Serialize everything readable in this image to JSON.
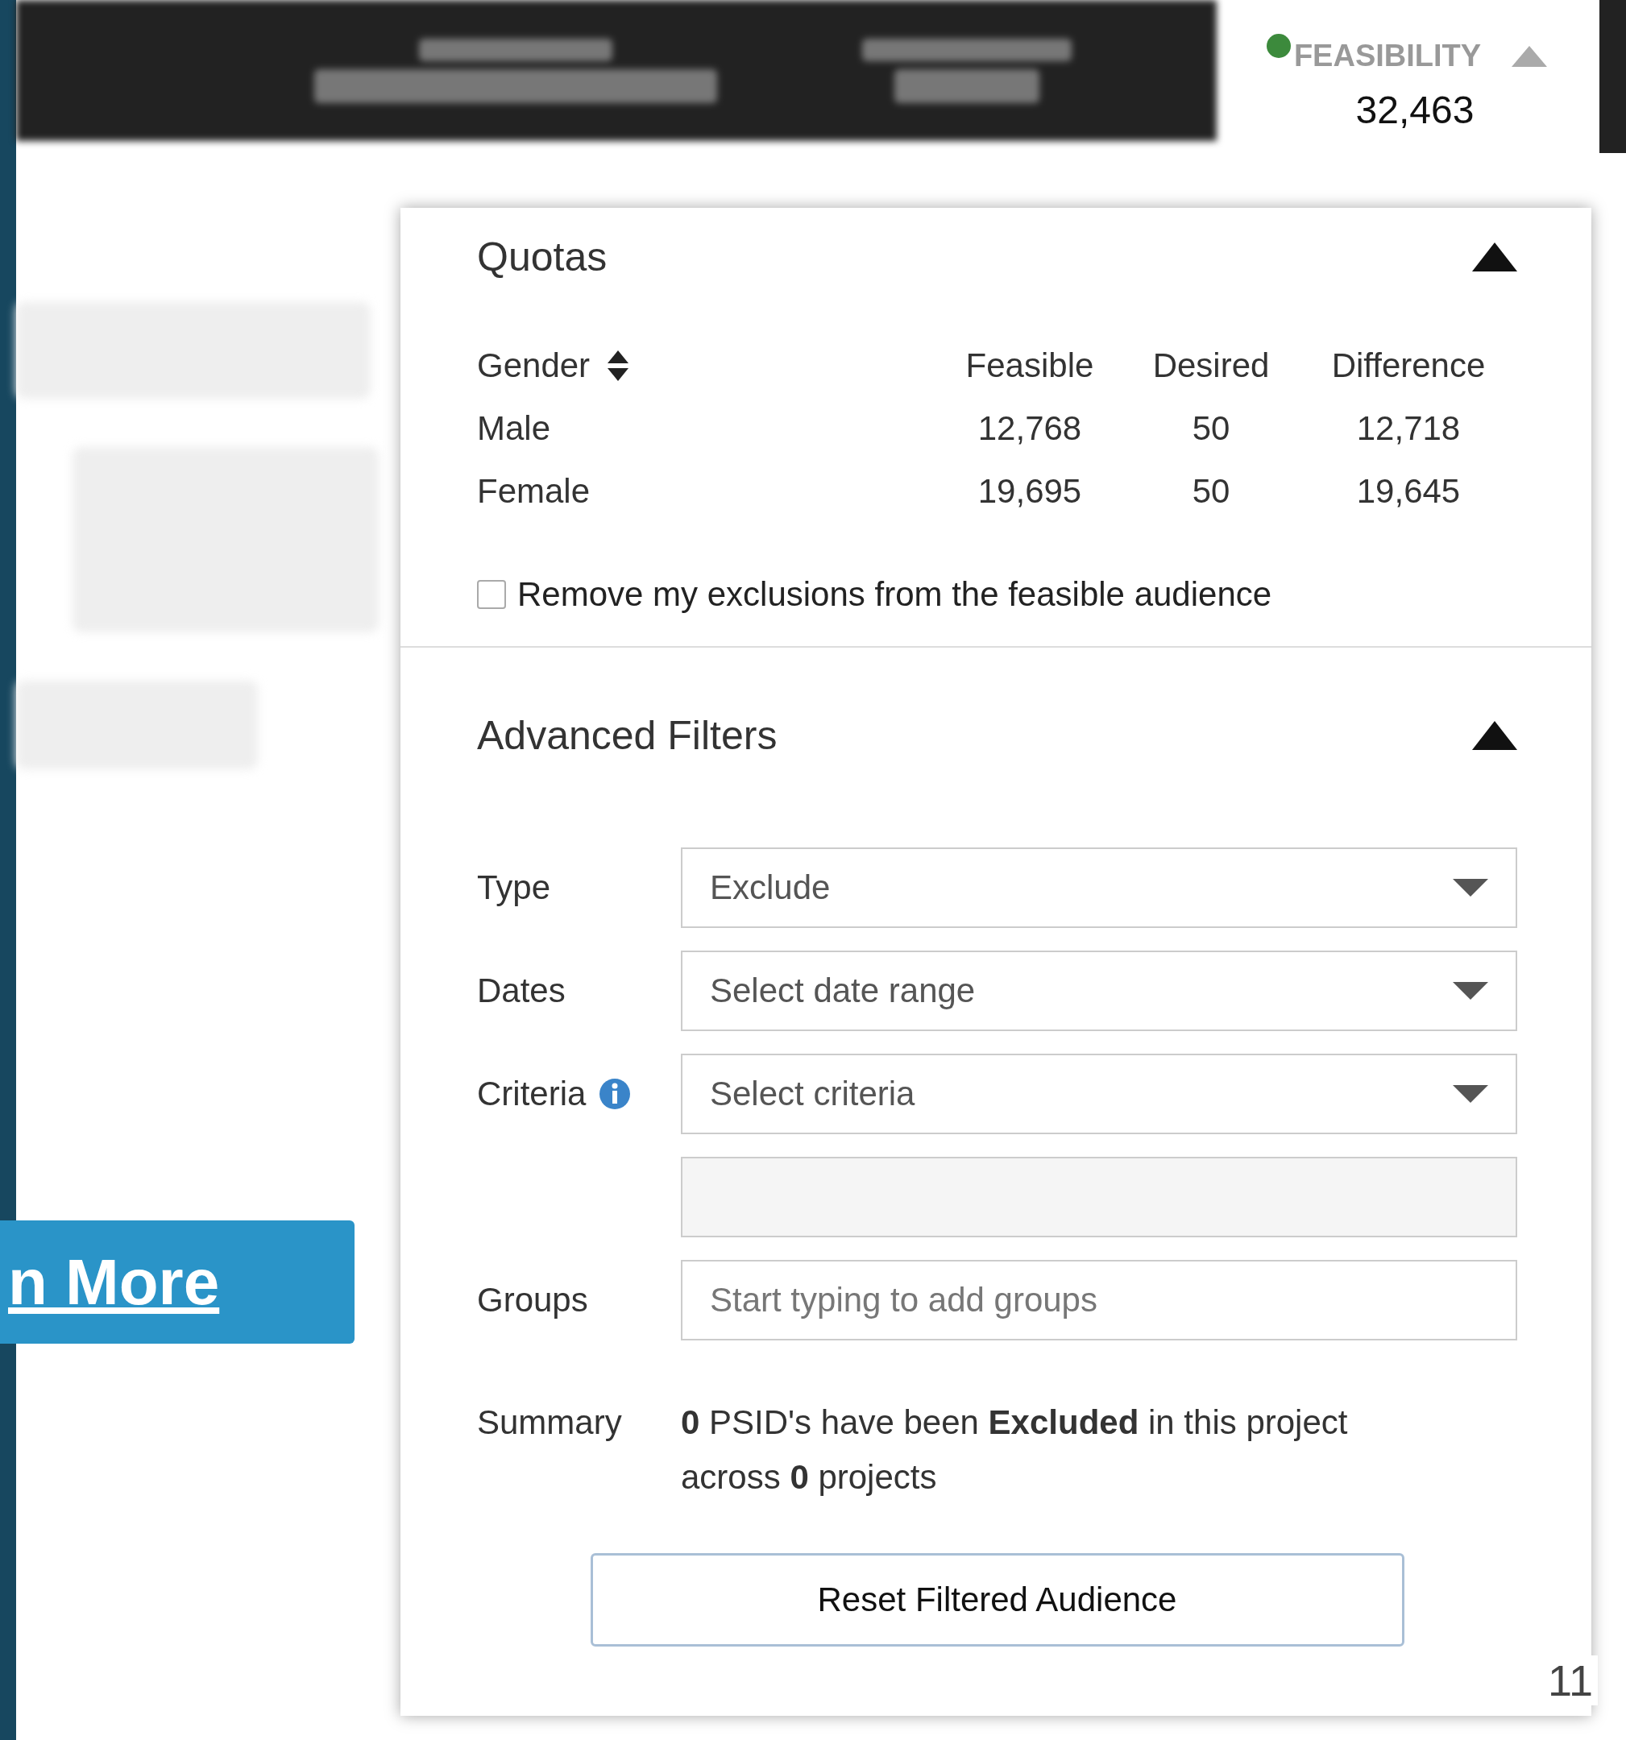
{
  "feasibility": {
    "label": "FEASIBILITY",
    "count": "32,463",
    "expanded": true
  },
  "learn_more_button": "n More",
  "quotas": {
    "title": "Quotas",
    "expanded": true,
    "columns": [
      "Gender",
      "Feasible",
      "Desired",
      "Difference"
    ],
    "rows": [
      [
        "Male",
        "12,768",
        "50",
        "12,718"
      ],
      [
        "Female",
        "19,695",
        "50",
        "19,645"
      ]
    ],
    "exclusion_checkbox": {
      "label": "Remove my exclusions from the feasible audience",
      "checked": false
    }
  },
  "advanced_filters": {
    "title": "Advanced Filters",
    "expanded": true,
    "fields": [
      {
        "kind": "select",
        "label": "Type",
        "value": "Exclude"
      },
      {
        "kind": "select",
        "label": "Dates",
        "placeholder": "Select date range"
      },
      {
        "kind": "select",
        "label": "Criteria",
        "info": true,
        "placeholder": "Select criteria"
      },
      {
        "kind": "blank"
      },
      {
        "kind": "text",
        "label": "Groups",
        "placeholder": "Start typing to add groups"
      }
    ],
    "summary_label": "Summary",
    "summary_text": "**0** PSID's have been **Excluded** in this project across **0** projects",
    "reset_button": "Reset Filtered Audience"
  },
  "page_number": "11"
}
